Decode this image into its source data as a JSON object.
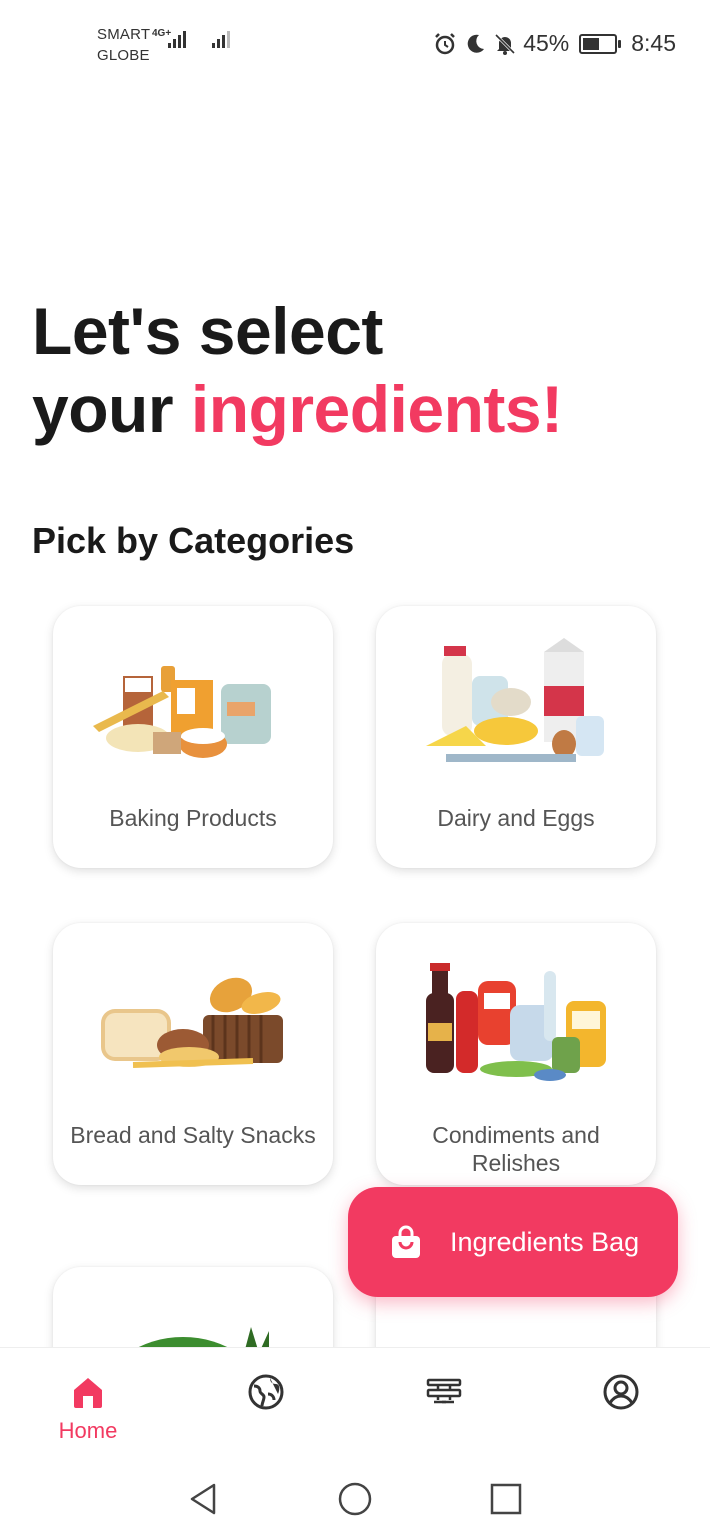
{
  "status_bar": {
    "carrier_line1": "SMART",
    "carrier_line2": "GLOBE",
    "network_type": "4G+",
    "battery_percent": "45%",
    "time": "8:45",
    "icons": [
      "alarm-icon",
      "moon-icon",
      "bell-off-icon",
      "battery-icon"
    ]
  },
  "header": {
    "line1": "Let's select",
    "line2_prefix": "your ",
    "line2_accent": "ingredients!"
  },
  "section": {
    "title": "Pick by Categories"
  },
  "categories": [
    {
      "label": "Baking Products",
      "icon": "baking-products-illustration"
    },
    {
      "label": "Dairy and Eggs",
      "icon": "dairy-eggs-illustration"
    },
    {
      "label": "Bread and Salty Snacks",
      "icon": "bread-snacks-illustration"
    },
    {
      "label": "Condiments and Relishes",
      "icon": "condiments-illustration"
    },
    {
      "label": "",
      "icon": "fruits-illustration"
    },
    {
      "label": "",
      "icon": "pasta-illustration"
    }
  ],
  "fab": {
    "label": "Ingredients Bag",
    "icon": "shopping-bag-icon"
  },
  "bottom_nav": {
    "items": [
      {
        "label": "Home",
        "icon": "home-icon",
        "active": true
      },
      {
        "label": "",
        "icon": "globe-icon",
        "active": false
      },
      {
        "label": "",
        "icon": "recipe-board-icon",
        "active": false
      },
      {
        "label": "",
        "icon": "profile-icon",
        "active": false
      }
    ]
  },
  "colors": {
    "accent": "#f23a61",
    "text_dark": "#1a1a1a",
    "text_muted": "#555555",
    "icon_dark": "#333333"
  }
}
